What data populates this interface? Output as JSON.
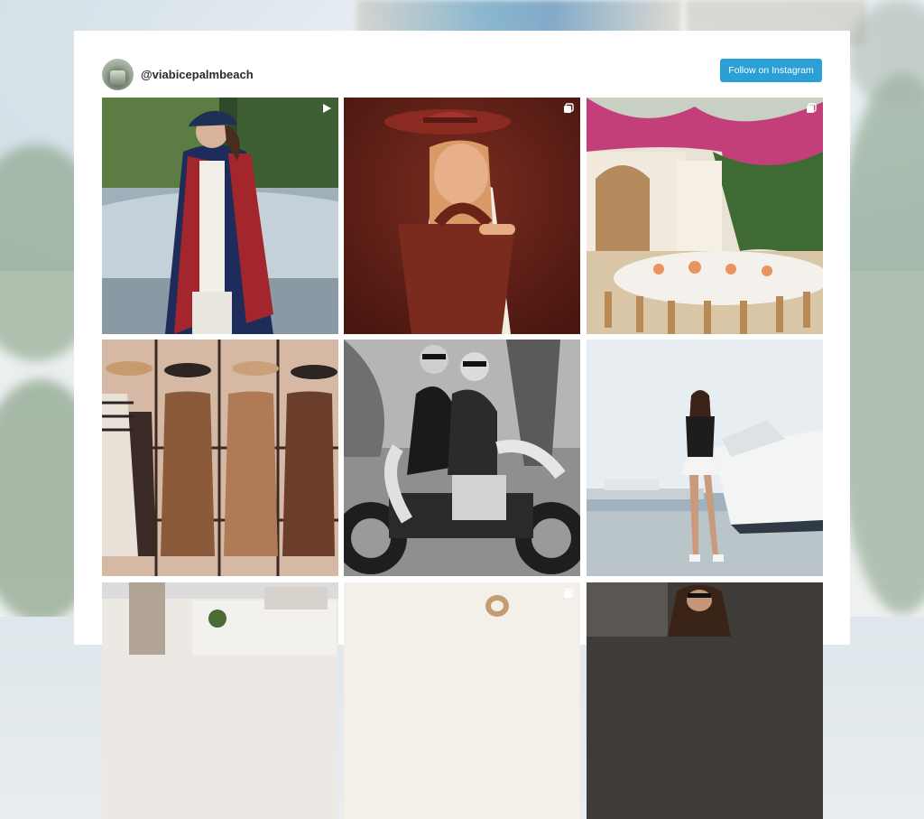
{
  "profile": {
    "handle": "@viabicepalmbeach",
    "follow_label": "Follow on Instagram"
  },
  "colors": {
    "accent": "#2aa0d6",
    "card": "#ffffff"
  },
  "posts": [
    {
      "type": "video",
      "badge_icon": "play-icon"
    },
    {
      "type": "carousel",
      "badge_icon": "gallery-icon"
    },
    {
      "type": "carousel",
      "badge_icon": "gallery-icon"
    },
    {
      "type": "image"
    },
    {
      "type": "image"
    },
    {
      "type": "image"
    },
    {
      "type": "image"
    },
    {
      "type": "carousel",
      "badge_icon": "gallery-icon"
    },
    {
      "type": "image"
    }
  ]
}
